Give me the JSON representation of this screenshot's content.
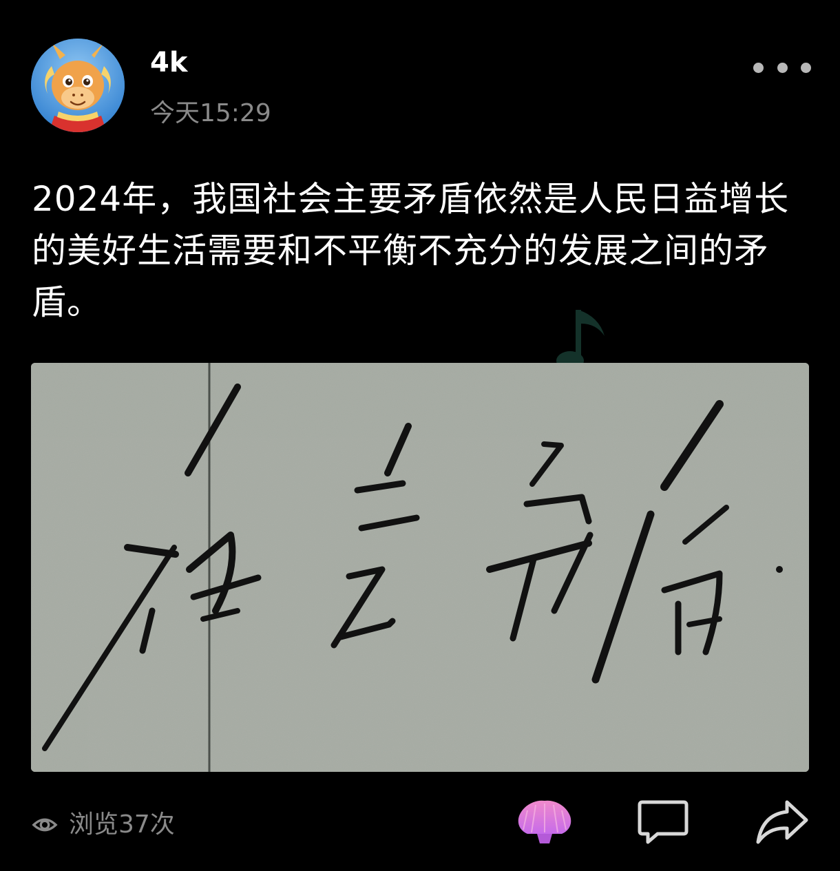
{
  "post": {
    "author": {
      "name": "4k",
      "avatar_icon": "dragon-avatar-icon"
    },
    "time": "今天15:29",
    "more_icon": "more-dots-icon",
    "text": "2024年，我国社会主要矛盾依然是人民日益增长的美好生活需要和不平衡不充分的发展之间的矛盾。",
    "image": {
      "calligraphy_text": "社会矛盾.",
      "paper_color": "#a5aaa2",
      "ink_color": "#111111"
    }
  },
  "footer": {
    "views_icon": "eye-icon",
    "views_label": "浏览37次",
    "actions": [
      {
        "name": "like",
        "icon": "shell-like-icon",
        "color": "#e479e9"
      },
      {
        "name": "comment",
        "icon": "comment-bubble-icon",
        "color": "#d8d8d8"
      },
      {
        "name": "share",
        "icon": "share-arrow-icon",
        "color": "#d8d8d8"
      }
    ]
  },
  "colors": {
    "background": "#000000",
    "primary_text": "#ffffff",
    "secondary_text": "#8a8a8a",
    "accent": "#e479e9"
  }
}
